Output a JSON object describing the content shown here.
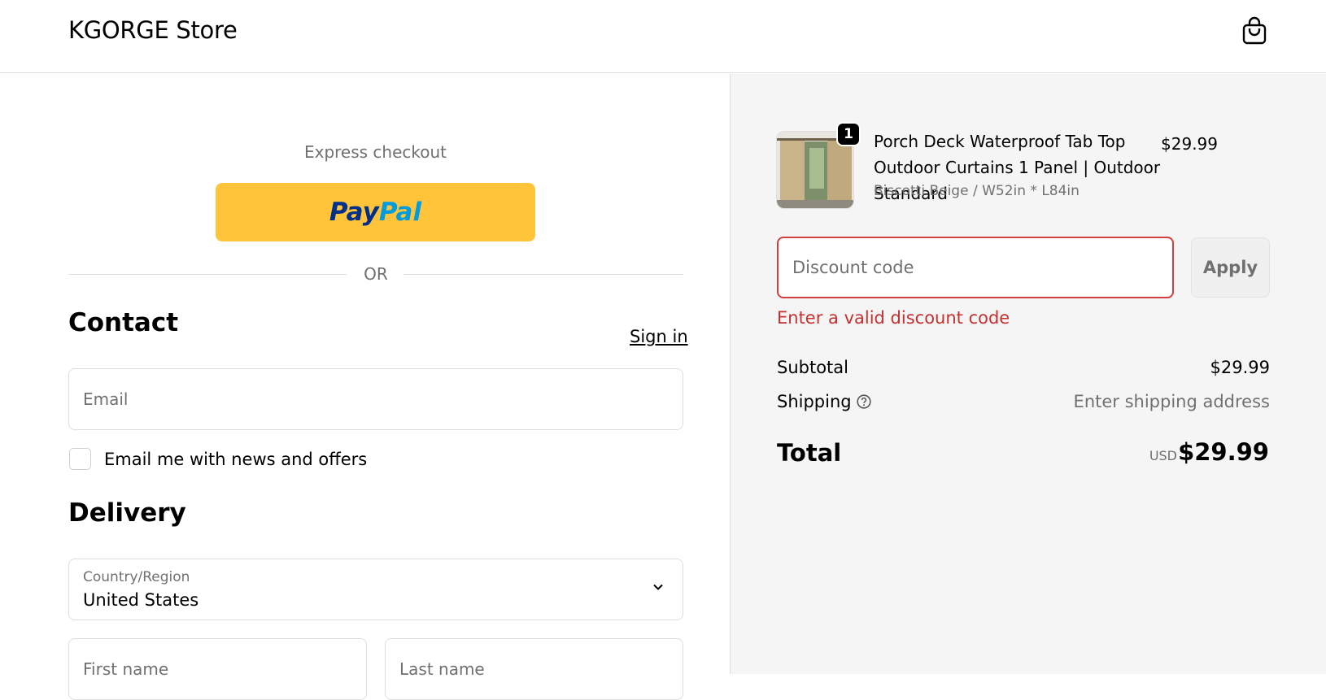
{
  "header": {
    "store_name": "KGORGE Store",
    "cart_icon": "shopping-bag-icon"
  },
  "checkout": {
    "express_label": "Express checkout",
    "paypal": {
      "pay": "Pay",
      "pal": "Pal"
    },
    "or_text": "OR",
    "contact": {
      "title": "Contact",
      "sign_in": "Sign in",
      "email_placeholder": "Email",
      "newsletter_label": "Email me with news and offers",
      "newsletter_checked": false
    },
    "delivery": {
      "title": "Delivery",
      "country_label": "Country/Region",
      "country_value": "United States",
      "first_name_placeholder": "First name",
      "last_name_placeholder": "Last name"
    }
  },
  "order_summary": {
    "item": {
      "quantity": "1",
      "name": "Porch Deck Waterproof Tab Top Outdoor Curtains 1 Panel | Outdoor Standard",
      "variant": "Biscotti Beige / W52in * L84in",
      "price": "$29.99"
    },
    "discount": {
      "placeholder": "Discount code",
      "apply_label": "Apply",
      "error": "Enter a valid discount code"
    },
    "subtotal_label": "Subtotal",
    "subtotal_value": "$29.99",
    "shipping_label": "Shipping",
    "shipping_value": "Enter shipping address",
    "total_label": "Total",
    "total_currency": "USD",
    "total_value": "$29.99"
  },
  "colors": {
    "paypal_yellow": "#ffc439",
    "error_red": "#c53030",
    "summary_bg": "#f5f5f5"
  }
}
